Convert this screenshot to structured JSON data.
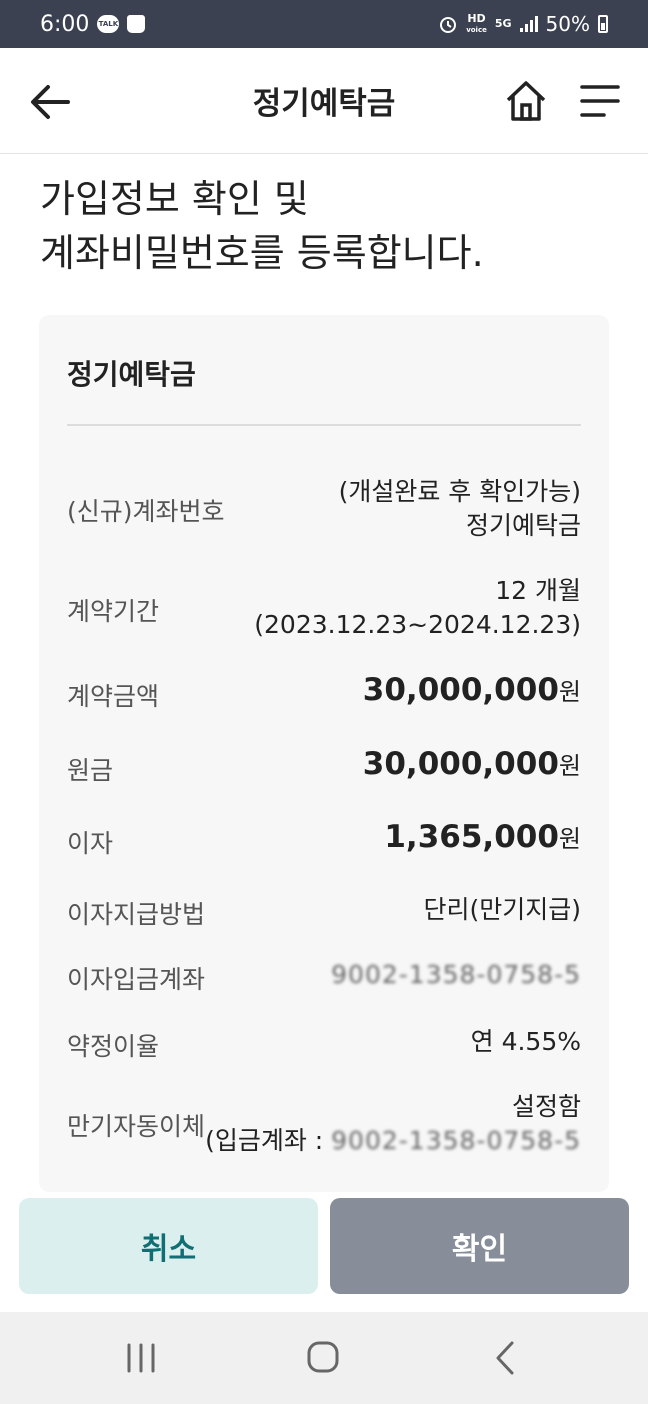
{
  "status_bar": {
    "time": "6:00",
    "talk_badge": "TALK",
    "hd_label": "HD",
    "voice_label": "voice",
    "network": "5G",
    "battery": "50%"
  },
  "header": {
    "title": "정기예탁금"
  },
  "heading": {
    "line1": "가입정보 확인 및",
    "line2": "계좌비밀번호를 등록합니다."
  },
  "card": {
    "title": "정기예탁금",
    "rows": [
      {
        "label": "(신규)계좌번호",
        "value_line1": "(개설완료 후 확인가능)",
        "value_line2": "정기예탁금"
      },
      {
        "label": "계약기간",
        "value_line1": "12 개월",
        "value_line2": "(2023.12.23~2024.12.23)"
      },
      {
        "label": "계약금액",
        "amount": "30,000,000",
        "unit": "원"
      },
      {
        "label": "원금",
        "amount": "30,000,000",
        "unit": "원"
      },
      {
        "label": "이자",
        "amount": "1,365,000",
        "unit": "원"
      },
      {
        "label": "이자지급방법",
        "value": "단리(만기지급)"
      },
      {
        "label": "이자입금계좌",
        "value": "9002-1358-0758-5"
      },
      {
        "label": "약정이율",
        "value": "연 4.55%"
      },
      {
        "label": "만기자동이체",
        "value_line1": "설정함",
        "value_prefix": "(입금계좌 : ",
        "value_masked": "9002-1358-0758-5"
      }
    ]
  },
  "buttons": {
    "cancel": "취소",
    "confirm": "확인"
  },
  "colors": {
    "status_bar_bg": "#3b4150",
    "cancel_bg": "#dcefef",
    "cancel_text": "#0f6f73",
    "confirm_bg": "#878e9a",
    "card_bg": "#f7f7f7"
  },
  "icons": {
    "back": "arrow-left-icon",
    "home": "home-icon",
    "menu": "hamburger-menu-icon",
    "nav_recents": "recents-icon",
    "nav_home": "home-circle-icon",
    "nav_back": "chevron-left-icon"
  }
}
